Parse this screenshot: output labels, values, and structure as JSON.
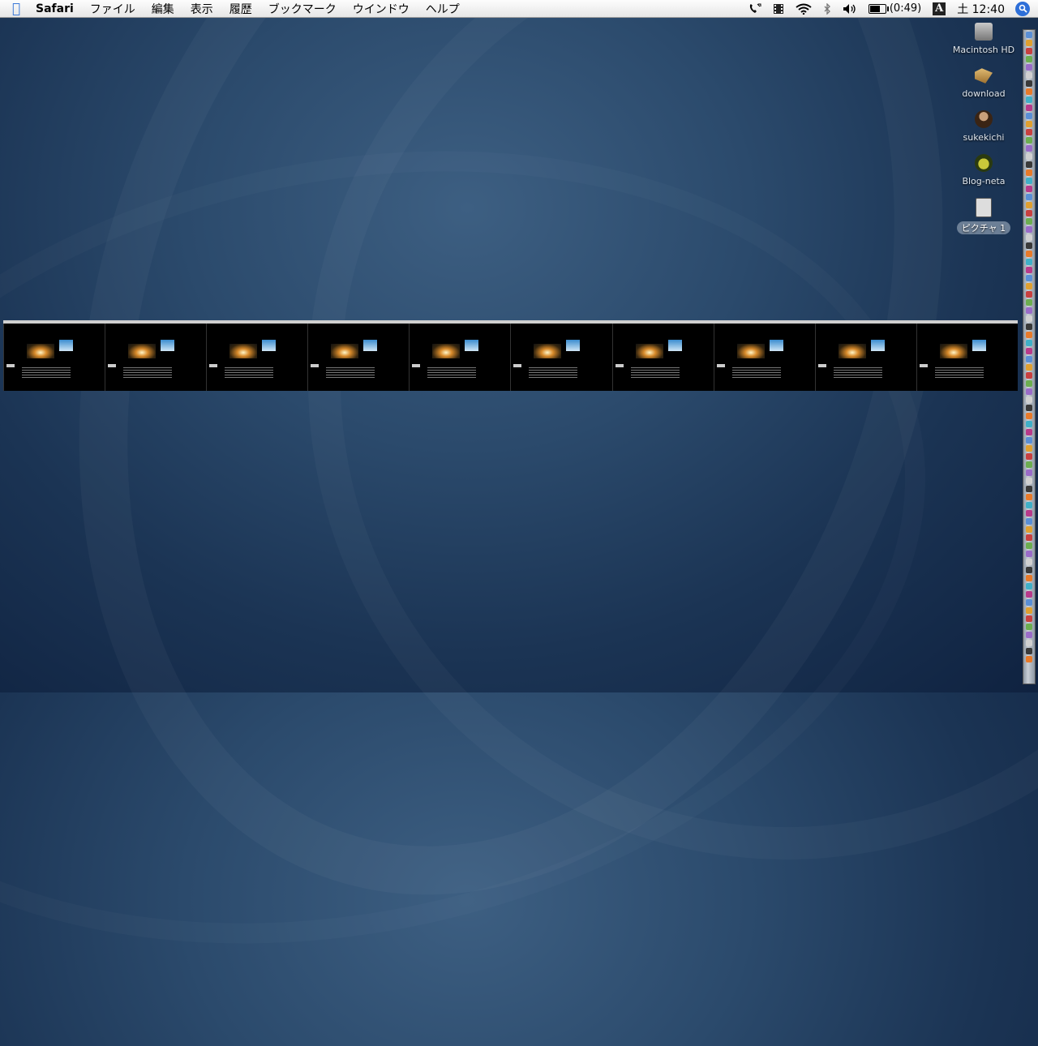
{
  "menubar": {
    "app_name": "Safari",
    "items": [
      "ファイル",
      "編集",
      "表示",
      "履歴",
      "ブックマーク",
      "ウインドウ",
      "ヘルプ"
    ],
    "battery_time": "(0:49)",
    "battery_level_percent": 70,
    "input_method": "A",
    "clock": "土 12:40",
    "status_icons": [
      "phone-icon",
      "film-icon",
      "wifi-icon",
      "bluetooth-icon",
      "volume-icon",
      "battery-icon"
    ]
  },
  "desktop": {
    "icons": [
      {
        "label": "Macintosh HD",
        "icon": "hard-drive-icon",
        "selected": false
      },
      {
        "label": "download",
        "icon": "folder-icon",
        "selected": false
      },
      {
        "label": "sukekichi",
        "icon": "user-icon",
        "selected": false
      },
      {
        "label": "Blog-neta",
        "icon": "blog-icon",
        "selected": false
      },
      {
        "label": "ピクチャ 1",
        "icon": "picture-file-icon",
        "selected": true
      }
    ]
  },
  "strip": {
    "thumbnail_count": 10
  },
  "colors": {
    "accent": "#2e6fd8",
    "menubar_bg": "#f2f2f2",
    "desktop_dark": "#0f2240"
  }
}
